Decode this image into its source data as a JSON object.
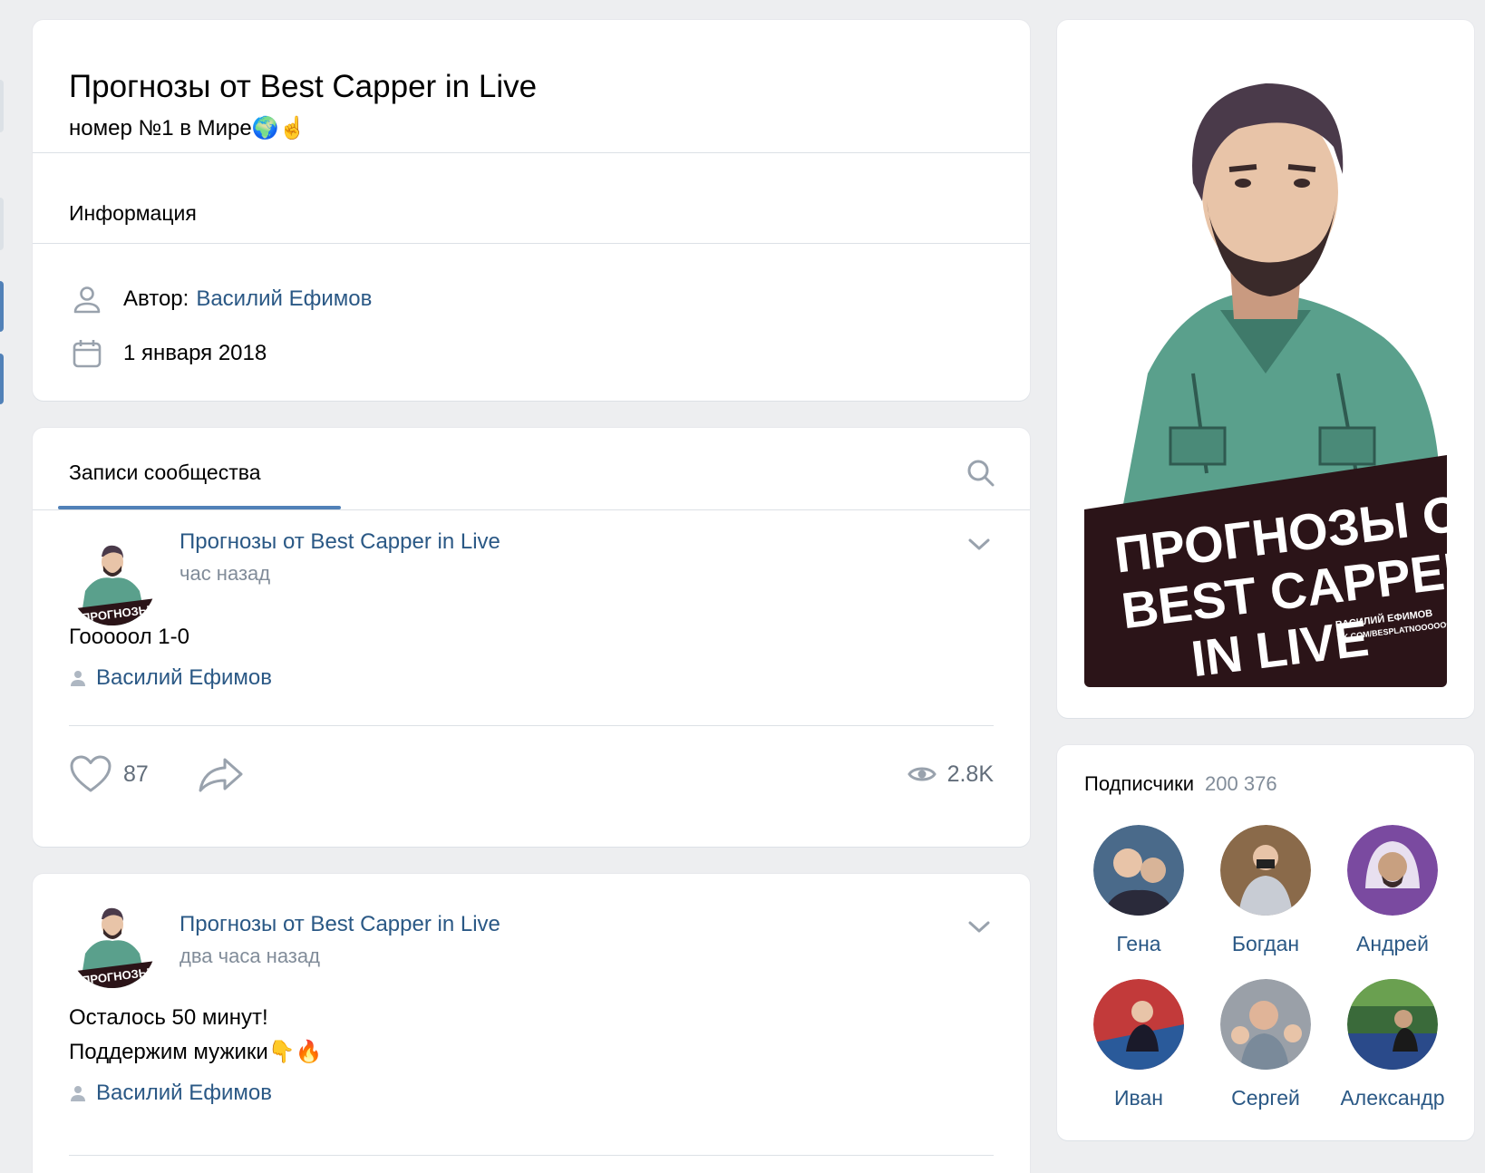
{
  "group": {
    "title": "Прогнозы от Best Capper in Live",
    "status": "номер №1 в Мире🌍☝️"
  },
  "info": {
    "section_label": "Информация",
    "author_label": "Автор:",
    "author_name": "Василий Ефимов",
    "founded": "1 января 2018"
  },
  "wall": {
    "tab_label": "Записи сообщества",
    "posts": [
      {
        "author": "Прогнозы от Best Capper in Live",
        "time": "час назад",
        "text_lines": [
          "Гооооол 1-0"
        ],
        "signer": "Василий Ефимов",
        "likes": "87",
        "views": "2.8K"
      },
      {
        "author": "Прогнозы от Best Capper in Live",
        "time": "два часа назад",
        "text_lines": [
          "Осталось 50 минут!",
          "Поддержим мужики👇🔥"
        ],
        "signer": "Василий Ефимов"
      }
    ]
  },
  "cover": {
    "line1": "ПРОГНОЗЫ ОТ",
    "line2": "BEST CAPPER",
    "line3": "IN LIVE",
    "sub1": "ВАСИЛИЙ ЕФИМОВ",
    "sub2": "VK.COM/BESPLATNOOOOOO"
  },
  "avatar_text": "ПРОГНОЗЫ ОТ",
  "subscribers": {
    "label": "Подписчики",
    "count": "200 376",
    "people": [
      {
        "name": "Гена",
        "color": "#4a6a8a"
      },
      {
        "name": "Богдан",
        "color": "#8a6a4a"
      },
      {
        "name": "Андрей",
        "color": "#7a4aa0"
      },
      {
        "name": "Иван",
        "color": "#c23a3a"
      },
      {
        "name": "Сергей",
        "color": "#9aa0a8"
      },
      {
        "name": "Александр",
        "color": "#3a6a3a"
      }
    ]
  },
  "colors": {
    "link": "#2a5885",
    "accent": "#5181b8",
    "cover_bg": "#2b1418",
    "shirt": "#5aa08c"
  }
}
